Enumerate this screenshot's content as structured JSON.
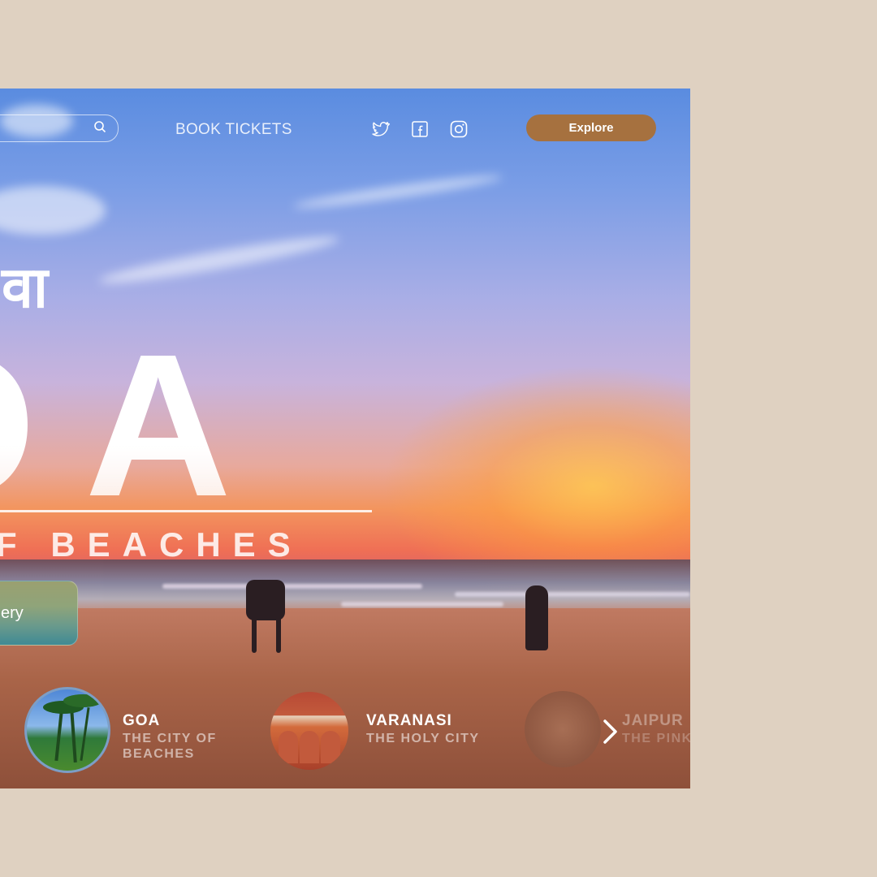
{
  "nav": {
    "search": {
      "placeholder": ""
    },
    "book_tickets": "BOOK TICKETS",
    "social_icons": [
      "twitter-icon",
      "facebook-icon",
      "instagram-icon"
    ],
    "explore_button": "Explore"
  },
  "hero": {
    "hindi_title": "वा",
    "big_title": "OA",
    "subtitle": "F BEACHES",
    "gallery_label": "ery"
  },
  "destinations": [
    {
      "title": "GOA",
      "subtitle": "THE CITY OF BEACHES"
    },
    {
      "title": "VARANASI",
      "subtitle": "THE HOLY CITY"
    },
    {
      "title": "JAIPUR",
      "subtitle": "THE PINK"
    }
  ],
  "colors": {
    "page_bg": "#dfd1c1",
    "explore_button": "#a6713f",
    "active_ring": "#7c9ec6"
  }
}
